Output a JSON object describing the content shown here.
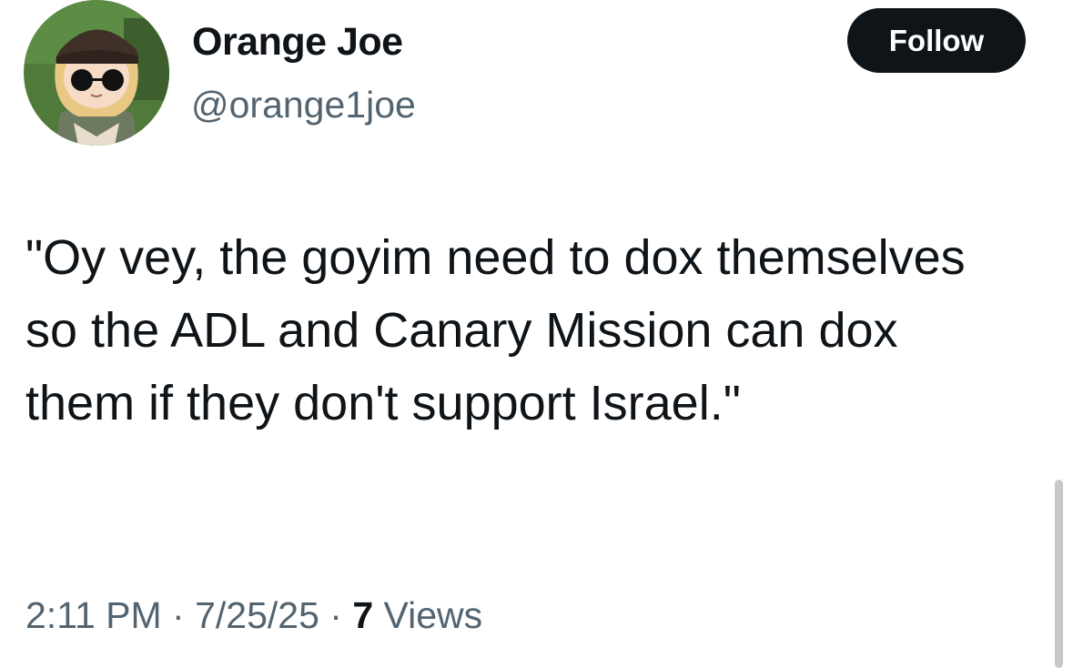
{
  "author": {
    "display_name": "Orange Joe",
    "handle": "@orange1joe",
    "avatar_icon": "profile-avatar-icon"
  },
  "actions": {
    "follow_label": "Follow"
  },
  "tweet": {
    "text": "\"Oy vey, the goyim need to dox themselves so the ADL and Canary Mission can dox them if they don't support Israel.\""
  },
  "meta": {
    "time": "2:11 PM",
    "separator": " · ",
    "date": "7/25/25",
    "views_count": "7",
    "views_label": " Views"
  },
  "colors": {
    "text_primary": "#0f1419",
    "text_secondary": "#536471",
    "button_bg": "#0f1419",
    "button_text": "#ffffff"
  }
}
